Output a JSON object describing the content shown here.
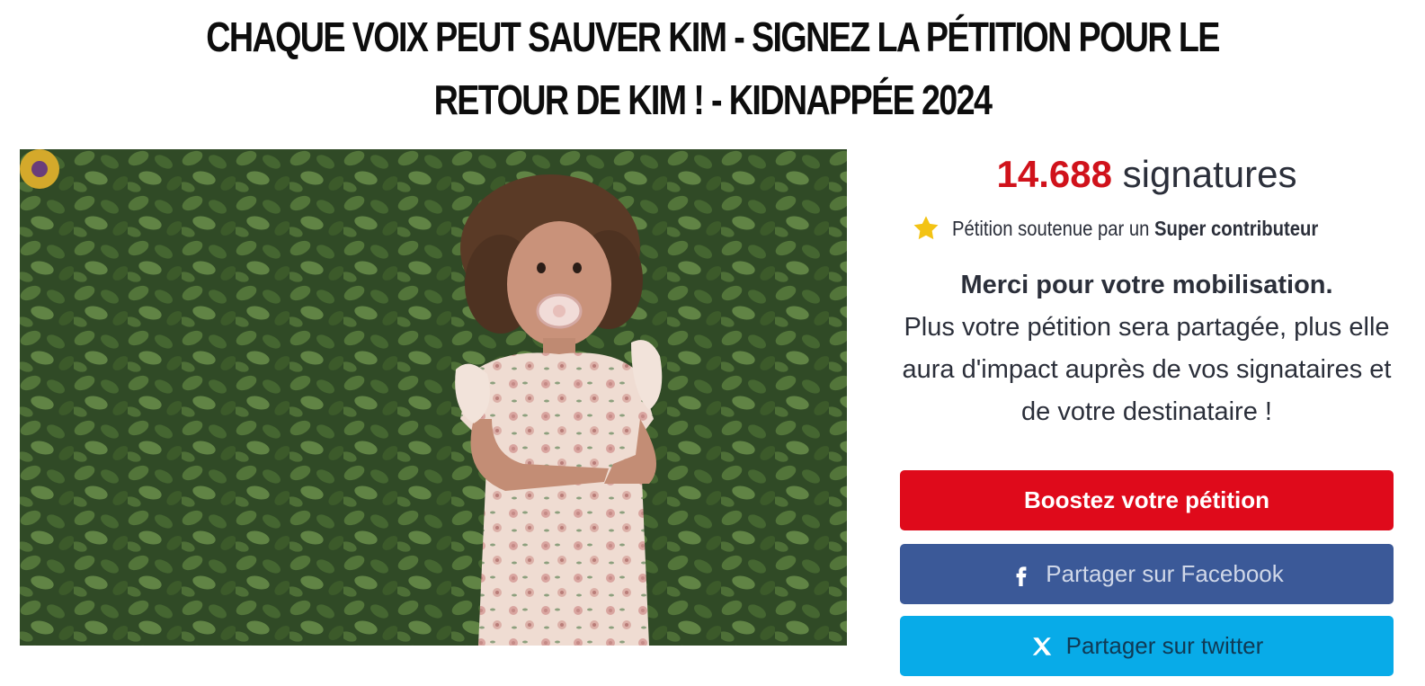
{
  "page": {
    "title": "CHAQUE VOIX PEUT SAUVER KIM - SIGNEZ LA PÉTITION POUR LE RETOUR DE KIM ! - KIDNAPPÉE 2024"
  },
  "signatures": {
    "count": "14.688",
    "label": "signatures"
  },
  "support": {
    "icon": "star-icon",
    "prefix": "Pétition soutenue par un",
    "highlight": "Super contributeur"
  },
  "thanks": {
    "heading": "Merci pour votre mobilisation.",
    "body": "Plus votre pétition sera partagée, plus elle aura d'impact auprès de vos signataires et de votre destinataire !"
  },
  "buttons": {
    "boost": "Boostez votre pétition",
    "facebook": "Partager sur Facebook",
    "twitter": "Partager sur twitter"
  },
  "colors": {
    "accent_red": "#df0a1b",
    "signature_count": "#d0121b",
    "facebook_blue": "#3b5998",
    "twitter_blue": "#08abe8",
    "star_yellow": "#f3c314"
  }
}
